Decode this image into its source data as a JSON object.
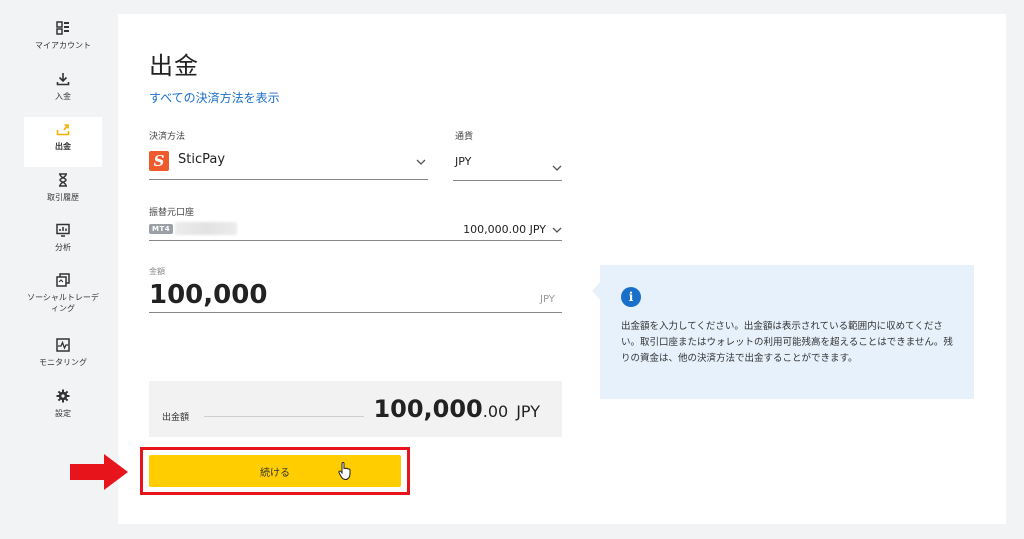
{
  "sidebar": {
    "items": [
      {
        "label": "マイアカウント",
        "icon": "grid-icon"
      },
      {
        "label": "入金",
        "icon": "download-icon"
      },
      {
        "label": "出金",
        "icon": "upload-icon",
        "active": true
      },
      {
        "label": "取引履歴",
        "icon": "hourglass-icon"
      },
      {
        "label": "分析",
        "icon": "analytics-icon"
      },
      {
        "label": "ソーシャルトレーディング",
        "icon": "social-trading-icon"
      },
      {
        "label": "モニタリング",
        "icon": "monitor-icon"
      },
      {
        "label": "設定",
        "icon": "gear-icon"
      }
    ]
  },
  "main": {
    "title": "出金",
    "all_methods_link": "すべての決済方法を表示",
    "payment_method": {
      "label": "決済方法",
      "value": "SticPay",
      "icon_letter": "S",
      "icon_color": "#ee5a2c"
    },
    "currency": {
      "label": "通貨",
      "value": "JPY"
    },
    "source_account": {
      "label": "振替元口座",
      "badge": "MT4",
      "balance": "100,000.00 JPY"
    },
    "amount": {
      "label": "金額",
      "value": "100,000",
      "unit": "JPY"
    },
    "summary": {
      "label": "出金額",
      "amount_int": "100,000",
      "amount_dec": ".00",
      "currency": "JPY"
    },
    "continue_label": "続ける"
  },
  "info": {
    "icon_letter": "i",
    "text": "出金額を入力してください。出金額は表示されている範囲内に収めてください。取引口座またはウォレットの利用可能残高を超えることはできません。残りの資金は、他の決済方法で出金することができます。"
  },
  "colors": {
    "accent_blue": "#1a6fc9",
    "button_yellow": "#ffcd00",
    "highlight_red": "#e8141c",
    "info_bg": "#e6f1fb"
  }
}
